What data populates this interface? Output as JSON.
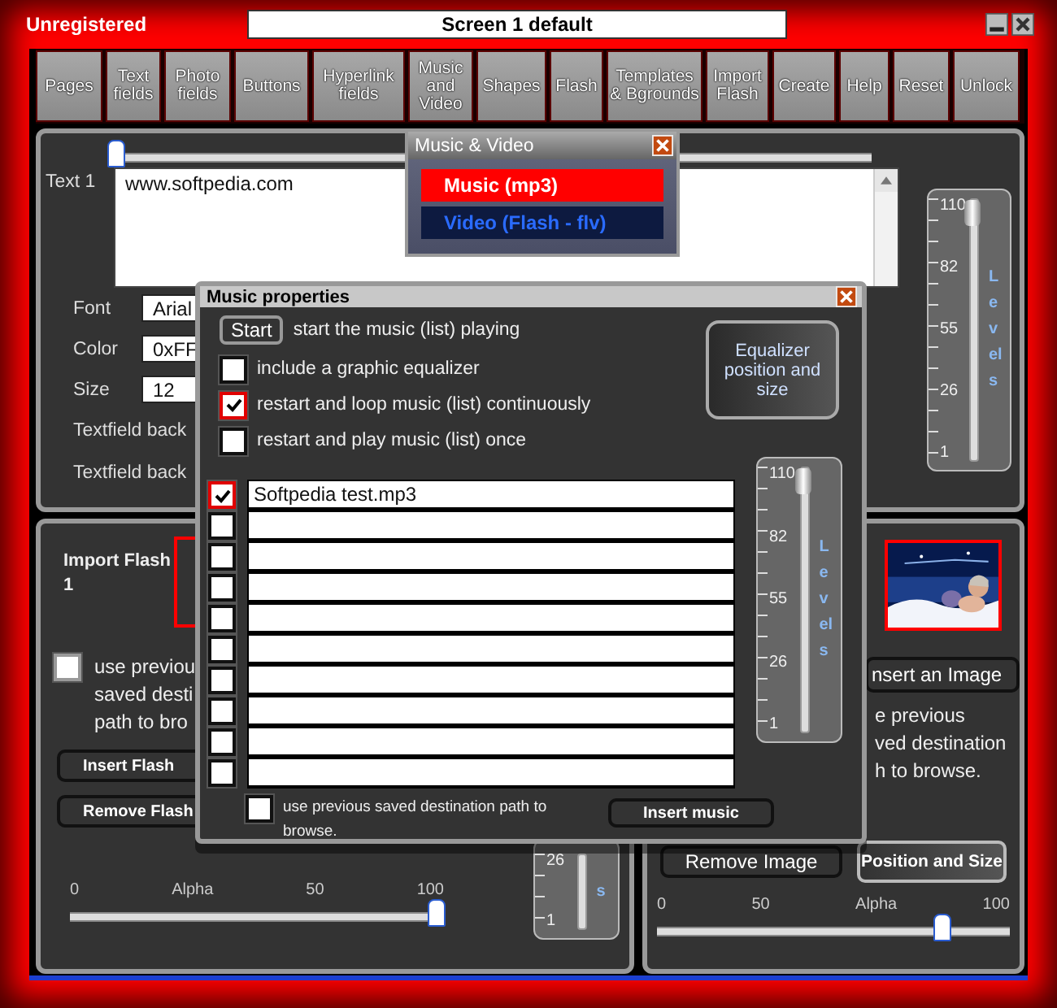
{
  "window": {
    "status": "Unregistered",
    "title": "Screen 1 default"
  },
  "toolbar": [
    {
      "label": "Pages"
    },
    {
      "label": "Text fields"
    },
    {
      "label": "Photo fields"
    },
    {
      "label": "Buttons"
    },
    {
      "label": "Hyperlink fields"
    },
    {
      "label": "Music and Video"
    },
    {
      "label": "Shapes"
    },
    {
      "label": "Flash"
    },
    {
      "label": "Templates & Bgrounds"
    },
    {
      "label": "Import Flash"
    },
    {
      "label": "Create"
    },
    {
      "label": "Help"
    },
    {
      "label": "Reset"
    },
    {
      "label": "Unlock"
    }
  ],
  "text_panel": {
    "position": {
      "level": 0
    },
    "label": "Text 1",
    "text": "www.softpedia.com",
    "fields": [
      {
        "label": "Font",
        "value": "Arial"
      },
      {
        "label": "Color",
        "value": "0xFF"
      },
      {
        "label": "Size",
        "value": "12"
      }
    ],
    "background_labels": [
      "Textfield back",
      "Textfield back"
    ],
    "levels": {
      "ticks": [
        "110",
        "82",
        "55",
        "26",
        "1"
      ],
      "caption": "Levels",
      "level": 1
    }
  },
  "flash_panel": {
    "title": "Import Flash 1",
    "path_option": {
      "checked": false,
      "lines": [
        "use previou",
        "saved desti",
        "path to bro"
      ]
    },
    "buttons": [
      "Insert Flash",
      "Remove Flash"
    ],
    "levels": {
      "ticks": [
        "26",
        "1"
      ],
      "caption": "s"
    },
    "alpha": {
      "labels": [
        "0",
        "Alpha",
        "50",
        "100"
      ],
      "level": 1
    }
  },
  "image_panel": {
    "insert_button": "nsert an Image",
    "note_lines": [
      "e previous",
      "ved destination",
      "h to browse."
    ],
    "buttons": [
      "Remove Image",
      "Position and Size"
    ],
    "alpha": {
      "labels": [
        "0",
        "50",
        "Alpha",
        "100"
      ],
      "level": 0.82
    }
  },
  "music_video_menu": {
    "title": "Music & Video",
    "items": [
      {
        "label": "Music (mp3)",
        "selected": true
      },
      {
        "label": "Video (Flash - flv)",
        "selected": false
      }
    ]
  },
  "music_dialog": {
    "title": "Music properties",
    "start_button": "Start",
    "start_text": "start the music (list) playing",
    "options": [
      {
        "label": "include a graphic equalizer",
        "checked": false
      },
      {
        "label": "restart and loop music (list) continuously",
        "checked": true
      },
      {
        "label": "restart and play music (list) once",
        "checked": false
      }
    ],
    "equalizer_button": "Equalizer position and size",
    "levels": {
      "ticks": [
        "110",
        "82",
        "55",
        "26",
        "1"
      ],
      "caption": "Levels",
      "level": 1
    },
    "files": [
      {
        "name": "Softpedia test.mp3",
        "checked": true
      },
      {
        "checked": false
      },
      {
        "checked": false
      },
      {
        "checked": false
      },
      {
        "checked": false
      },
      {
        "checked": false
      },
      {
        "checked": false
      },
      {
        "checked": false
      },
      {
        "checked": false
      },
      {
        "checked": false
      }
    ],
    "path_option": {
      "label": "use previous saved destination path to browse.",
      "checked": false
    },
    "insert_button": "Insert music"
  }
}
